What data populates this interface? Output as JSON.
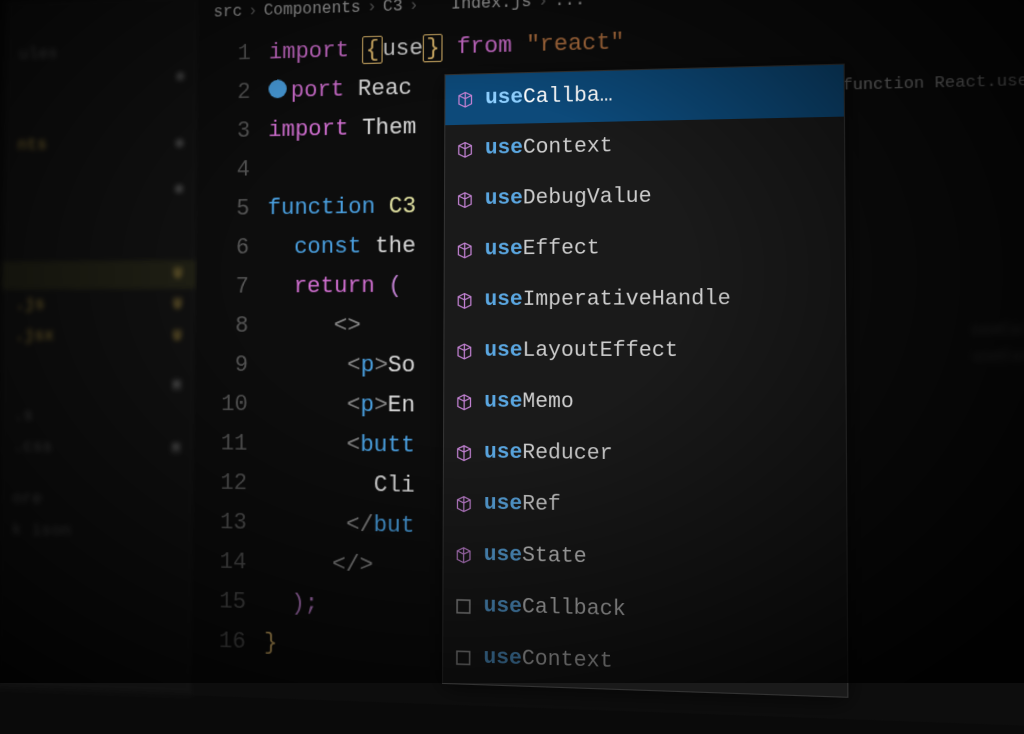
{
  "breadcrumb": {
    "seg1": "src",
    "seg2": "Components",
    "seg3": "C3",
    "seg4": "Index.js",
    "seg5": "..."
  },
  "sidebar": {
    "items": [
      {
        "label": "ules",
        "badge": ""
      },
      {
        "label": "",
        "badge": "•"
      },
      {
        "label": "nts",
        "badge": "•"
      },
      {
        "label": "",
        "badge": "•"
      },
      {
        "label": "",
        "badge": "U"
      },
      {
        "label": ".js",
        "badge": "U"
      },
      {
        "label": ".jsx",
        "badge": "U"
      },
      {
        "label": "",
        "badge": "M"
      },
      {
        "label": ".s",
        "badge": ""
      },
      {
        "label": ".css",
        "badge": "M"
      },
      {
        "label": "ore",
        "badge": ""
      },
      {
        "label": "k ison",
        "badge": ""
      }
    ]
  },
  "code": {
    "l1": {
      "import": "import",
      "open": "{",
      "use": "use",
      "close": "}",
      "from": "from",
      "str": "\"react\""
    },
    "l2": {
      "import": "port",
      "ident": "Reac"
    },
    "l3": {
      "import": "import",
      "ident": "Them"
    },
    "l5": {
      "fn": "function",
      "name": "C3"
    },
    "l6": {
      "const": "const",
      "ident": "the"
    },
    "l7": {
      "return": "return"
    },
    "l8": {
      "angle": "<>"
    },
    "l9": {
      "tag": "<p>",
      "txt": "So"
    },
    "l10": {
      "tag": "<p>",
      "txt": "En"
    },
    "l11": {
      "tag": "<butt"
    },
    "l12": {
      "txt": "Cli"
    },
    "l13": {
      "tag": "</but"
    },
    "l14": {
      "angle": "</>"
    },
    "l15": {
      "paren": ");"
    }
  },
  "line_numbers": [
    "1",
    "2",
    "3",
    "4",
    "5",
    "6",
    "7",
    "8",
    "9",
    "10",
    "11",
    "12",
    "13",
    "14",
    "15",
    "16"
  ],
  "autocomplete": {
    "detail": "function React.useCallback<T extends...",
    "items": [
      {
        "hl": "use",
        "rest": "Callba…",
        "kind": "cube",
        "selected": true
      },
      {
        "hl": "use",
        "rest": "Context",
        "kind": "cube"
      },
      {
        "hl": "use",
        "rest": "DebugValue",
        "kind": "cube"
      },
      {
        "hl": "use",
        "rest": "Effect",
        "kind": "cube"
      },
      {
        "hl": "use",
        "rest": "ImperativeHandle",
        "kind": "cube"
      },
      {
        "hl": "use",
        "rest": "LayoutEffect",
        "kind": "cube"
      },
      {
        "hl": "use",
        "rest": "Memo",
        "kind": "cube"
      },
      {
        "hl": "use",
        "rest": "Reducer",
        "kind": "cube"
      },
      {
        "hl": "use",
        "rest": "Ref",
        "kind": "cube"
      },
      {
        "hl": "use",
        "rest": "State",
        "kind": "cube"
      },
      {
        "hl": "use",
        "rest": "Callback",
        "kind": "box"
      },
      {
        "hl": "use",
        "rest": "Context",
        "kind": "box"
      }
    ]
  },
  "right_hints": {
    "h1": "useCallback",
    "h2": "useContext"
  }
}
